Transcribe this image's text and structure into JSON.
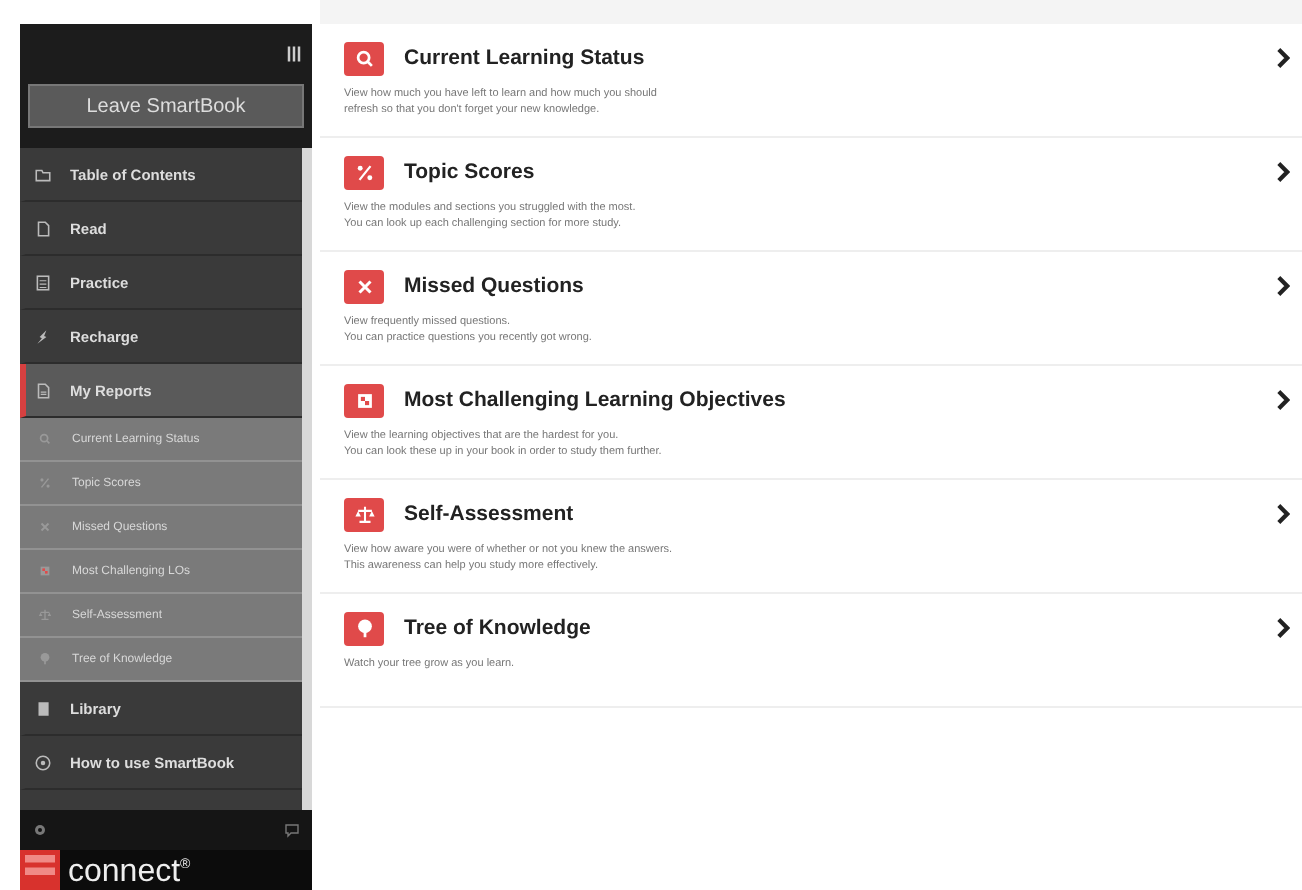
{
  "sidebar": {
    "leave_button": "Leave SmartBook",
    "items": [
      {
        "label": "Table of Contents",
        "kind": "folder",
        "selected": false
      },
      {
        "label": "Read",
        "kind": "page",
        "selected": false
      },
      {
        "label": "Practice",
        "kind": "list",
        "selected": false
      },
      {
        "label": "Recharge",
        "kind": "bolt",
        "selected": false
      },
      {
        "label": "My Reports",
        "kind": "report",
        "selected": true,
        "children": [
          {
            "label": "Current Learning Status",
            "kind": "search"
          },
          {
            "label": "Topic Scores",
            "kind": "percent"
          },
          {
            "label": "Missed Questions",
            "kind": "x"
          },
          {
            "label": "Most Challenging LOs",
            "kind": "grid"
          },
          {
            "label": "Self-Assessment",
            "kind": "scale"
          },
          {
            "label": "Tree of Knowledge",
            "kind": "tree"
          }
        ]
      },
      {
        "label": "Library",
        "kind": "book",
        "selected": false
      },
      {
        "label": "How to use SmartBook",
        "kind": "help",
        "selected": false
      }
    ],
    "logo": "connect$^{®}$"
  },
  "reports": [
    {
      "title": "Current Learning Status",
      "kind": "search",
      "lines": [
        "View how much you have left to learn and how much you should",
        "refresh so that you don't forget your new knowledge."
      ]
    },
    {
      "title": "Topic Scores",
      "kind": "percent",
      "lines": [
        "View the modules and sections you struggled with the most.",
        "You can look up each challenging section for more study."
      ]
    },
    {
      "title": "Missed Questions",
      "kind": "x",
      "lines": [
        "View frequently missed questions.",
        "You can practice questions you recently got wrong."
      ]
    },
    {
      "title": "Most Challenging Learning Objectives",
      "kind": "grid",
      "lines": [
        "View the learning objectives that are the hardest for you.",
        "You can look these up in your book in order to study them further."
      ]
    },
    {
      "title": "Self-Assessment",
      "kind": "scale",
      "lines": [
        "View how aware you were of whether or not you knew the answers.",
        "This awareness can help you study more effectively."
      ]
    },
    {
      "title": "Tree of Knowledge",
      "kind": "tree",
      "lines": [
        "Watch your tree grow as you learn."
      ]
    }
  ]
}
